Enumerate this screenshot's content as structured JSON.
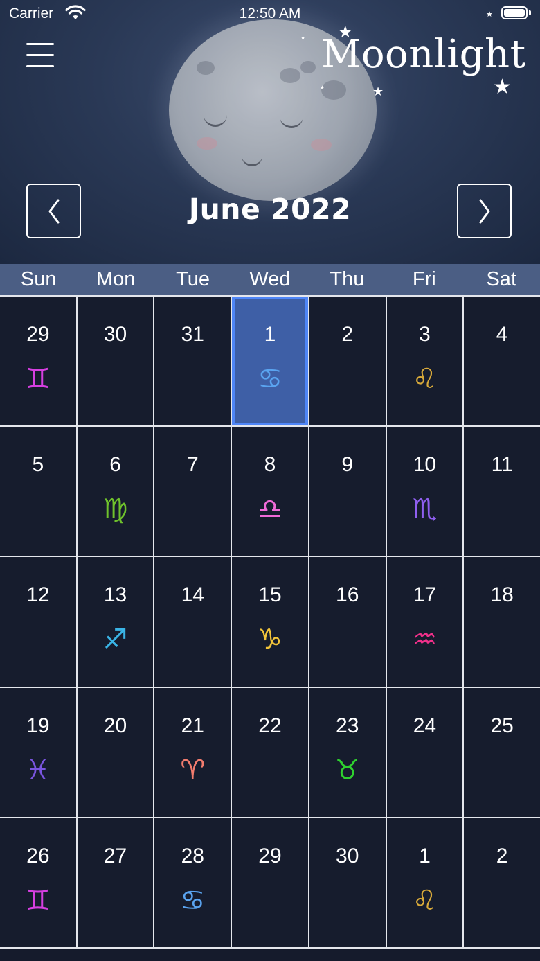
{
  "status_bar": {
    "carrier": "Carrier",
    "time": "12:50 AM",
    "wifi_icon": "wifi-icon",
    "battery_level": 1.0
  },
  "header": {
    "app_title": "Moonlight",
    "menu_icon": "hamburger-menu-icon",
    "month_label": "June 2022",
    "prev_icon": "chevron-left-icon",
    "next_icon": "chevron-right-icon"
  },
  "weekdays": [
    "Sun",
    "Mon",
    "Tue",
    "Wed",
    "Thu",
    "Fri",
    "Sat"
  ],
  "zodiac_colors": {
    "gemini": "#d63fe0",
    "cancer": "#5aa4f0",
    "leo": "#d9aa3a",
    "virgo": "#6fc22c",
    "libra": "#f06ad8",
    "scorpio": "#8f5ff0",
    "sagittarius": "#3ab4e6",
    "capricorn": "#f2c43a",
    "aquarius": "#f0308a",
    "pisces": "#7a55e0",
    "aries": "#f27c6e",
    "taurus": "#2fd12f"
  },
  "calendar": {
    "selected_day_color": "#3e5fa6",
    "days": [
      {
        "day": "29",
        "sign": "gemini",
        "glyph": "♊",
        "selected": false
      },
      {
        "day": "30",
        "sign": "",
        "glyph": "",
        "selected": false
      },
      {
        "day": "31",
        "sign": "",
        "glyph": "",
        "selected": false
      },
      {
        "day": "1",
        "sign": "cancer",
        "glyph": "♋",
        "selected": true
      },
      {
        "day": "2",
        "sign": "",
        "glyph": "",
        "selected": false
      },
      {
        "day": "3",
        "sign": "leo",
        "glyph": "♌",
        "selected": false
      },
      {
        "day": "4",
        "sign": "",
        "glyph": "",
        "selected": false
      },
      {
        "day": "5",
        "sign": "",
        "glyph": "",
        "selected": false
      },
      {
        "day": "6",
        "sign": "virgo",
        "glyph": "♍",
        "selected": false
      },
      {
        "day": "7",
        "sign": "",
        "glyph": "",
        "selected": false
      },
      {
        "day": "8",
        "sign": "libra",
        "glyph": "♎",
        "selected": false
      },
      {
        "day": "9",
        "sign": "",
        "glyph": "",
        "selected": false
      },
      {
        "day": "10",
        "sign": "scorpio",
        "glyph": "♏",
        "selected": false
      },
      {
        "day": "11",
        "sign": "",
        "glyph": "",
        "selected": false
      },
      {
        "day": "12",
        "sign": "",
        "glyph": "",
        "selected": false
      },
      {
        "day": "13",
        "sign": "sagittarius",
        "glyph": "♐",
        "selected": false
      },
      {
        "day": "14",
        "sign": "",
        "glyph": "",
        "selected": false
      },
      {
        "day": "15",
        "sign": "capricorn",
        "glyph": "♑",
        "selected": false
      },
      {
        "day": "16",
        "sign": "",
        "glyph": "",
        "selected": false
      },
      {
        "day": "17",
        "sign": "aquarius",
        "glyph": "♒",
        "selected": false
      },
      {
        "day": "18",
        "sign": "",
        "glyph": "",
        "selected": false
      },
      {
        "day": "19",
        "sign": "pisces",
        "glyph": "♓",
        "selected": false
      },
      {
        "day": "20",
        "sign": "",
        "glyph": "",
        "selected": false
      },
      {
        "day": "21",
        "sign": "aries",
        "glyph": "♈",
        "selected": false
      },
      {
        "day": "22",
        "sign": "",
        "glyph": "",
        "selected": false
      },
      {
        "day": "23",
        "sign": "taurus",
        "glyph": "♉",
        "selected": false
      },
      {
        "day": "24",
        "sign": "",
        "glyph": "",
        "selected": false
      },
      {
        "day": "25",
        "sign": "",
        "glyph": "",
        "selected": false
      },
      {
        "day": "26",
        "sign": "gemini",
        "glyph": "♊",
        "selected": false
      },
      {
        "day": "27",
        "sign": "",
        "glyph": "",
        "selected": false
      },
      {
        "day": "28",
        "sign": "cancer",
        "glyph": "♋",
        "selected": false
      },
      {
        "day": "29",
        "sign": "",
        "glyph": "",
        "selected": false
      },
      {
        "day": "30",
        "sign": "",
        "glyph": "",
        "selected": false
      },
      {
        "day": "1",
        "sign": "leo",
        "glyph": "♌",
        "selected": false
      },
      {
        "day": "2",
        "sign": "",
        "glyph": "",
        "selected": false
      }
    ]
  }
}
